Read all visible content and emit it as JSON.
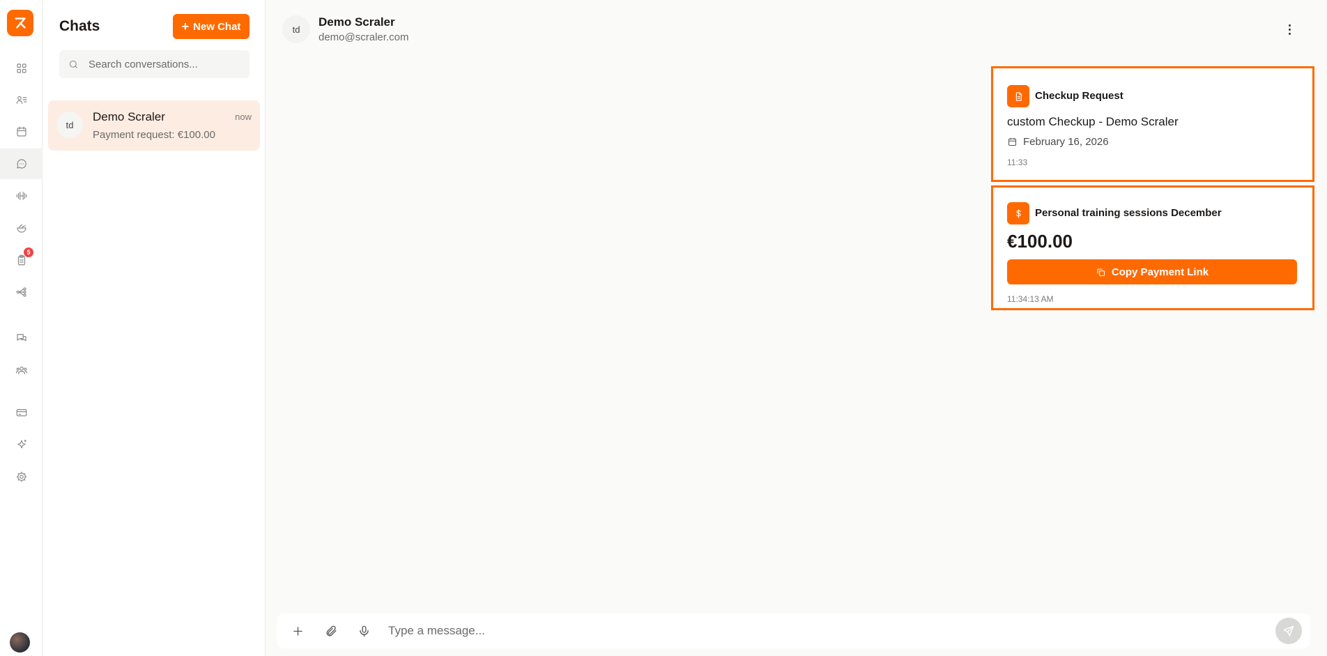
{
  "colors": {
    "accent": "#ff6a00",
    "badge": "#ef4444",
    "selected_bg": "#fdece2"
  },
  "rail": {
    "items": [
      {
        "name": "dashboard",
        "icon": "grid-icon"
      },
      {
        "name": "clients",
        "icon": "users-list-icon"
      },
      {
        "name": "calendar",
        "icon": "calendar-icon"
      },
      {
        "name": "chats",
        "icon": "chat-bubble-icon",
        "active": true
      },
      {
        "name": "workouts",
        "icon": "dumbbell-icon"
      },
      {
        "name": "nutrition",
        "icon": "salad-bowl-icon"
      },
      {
        "name": "checkups",
        "icon": "clipboard-icon",
        "badge": "5"
      },
      {
        "name": "automations",
        "icon": "workflow-icon"
      },
      {
        "name": "community",
        "icon": "chats-icon"
      },
      {
        "name": "groups",
        "icon": "team-icon"
      },
      {
        "name": "billing",
        "icon": "credit-card-icon"
      },
      {
        "name": "ai",
        "icon": "sparkles-icon"
      },
      {
        "name": "settings",
        "icon": "gear-icon"
      }
    ]
  },
  "chats_panel": {
    "title": "Chats",
    "new_chat_label": "New Chat",
    "search_placeholder": "Search conversations...",
    "conversations": [
      {
        "initials": "td",
        "name": "Demo Scraler",
        "time": "now",
        "preview": "Payment request: €100.00"
      }
    ]
  },
  "header": {
    "initials": "td",
    "name": "Demo Scraler",
    "email": "demo@scraler.com"
  },
  "messages": {
    "checkup": {
      "title": "Checkup Request",
      "subtitle": "custom Checkup - Demo Scraler",
      "date": "February 16, 2026",
      "time": "11:33"
    },
    "payment": {
      "title": "Personal training sessions December",
      "amount": "€100.00",
      "button_label": "Copy Payment Link",
      "time": "11:34:13 AM"
    }
  },
  "composer": {
    "placeholder": "Type a message..."
  }
}
